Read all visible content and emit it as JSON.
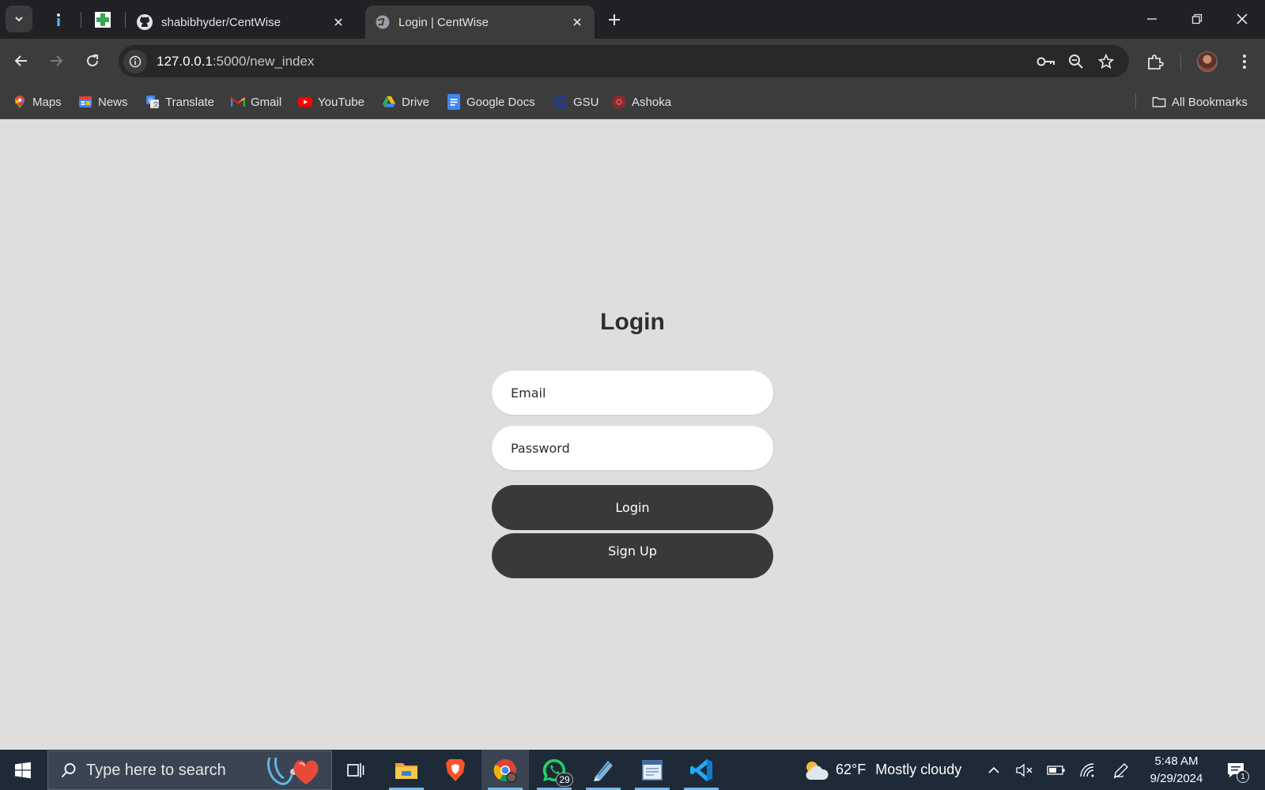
{
  "browser": {
    "tabs": [
      {
        "title": "shabibhyder/CentWise",
        "icon": "github-icon",
        "active": false
      },
      {
        "title": "Login | CentWise",
        "icon": "globe-icon",
        "active": true
      }
    ],
    "address": {
      "host": "127.0.0.1",
      "rest": ":5000/new_index"
    },
    "bookmarks": [
      {
        "label": "Maps",
        "icon": "maps-icon"
      },
      {
        "label": "News",
        "icon": "news-icon"
      },
      {
        "label": "Translate",
        "icon": "translate-icon"
      },
      {
        "label": "Gmail",
        "icon": "gmail-icon"
      },
      {
        "label": "YouTube",
        "icon": "youtube-icon"
      },
      {
        "label": "Drive",
        "icon": "drive-icon"
      },
      {
        "label": "Google Docs",
        "icon": "docs-icon"
      },
      {
        "label": "GSU",
        "icon": "gsu-icon"
      },
      {
        "label": "Ashoka",
        "icon": "ashoka-icon"
      }
    ],
    "all_bookmarks_label": "All Bookmarks"
  },
  "page": {
    "title": "Login",
    "email_placeholder": "Email",
    "password_placeholder": "Password",
    "login_label": "Login",
    "signup_label": "Sign Up"
  },
  "taskbar": {
    "search_placeholder": "Type here to search",
    "whatsapp_badge": "29",
    "weather_temp": "62°F",
    "weather_desc": "Mostly cloudy",
    "time": "5:48 AM",
    "date": "9/29/2024",
    "notification_count": "1"
  },
  "colors": {
    "page_bg": "#dedede",
    "button_bg": "#383a38",
    "chrome_dark": "#202124",
    "chrome_toolbar": "#3c3c3c",
    "taskbar_bg": "#1f2a38"
  }
}
